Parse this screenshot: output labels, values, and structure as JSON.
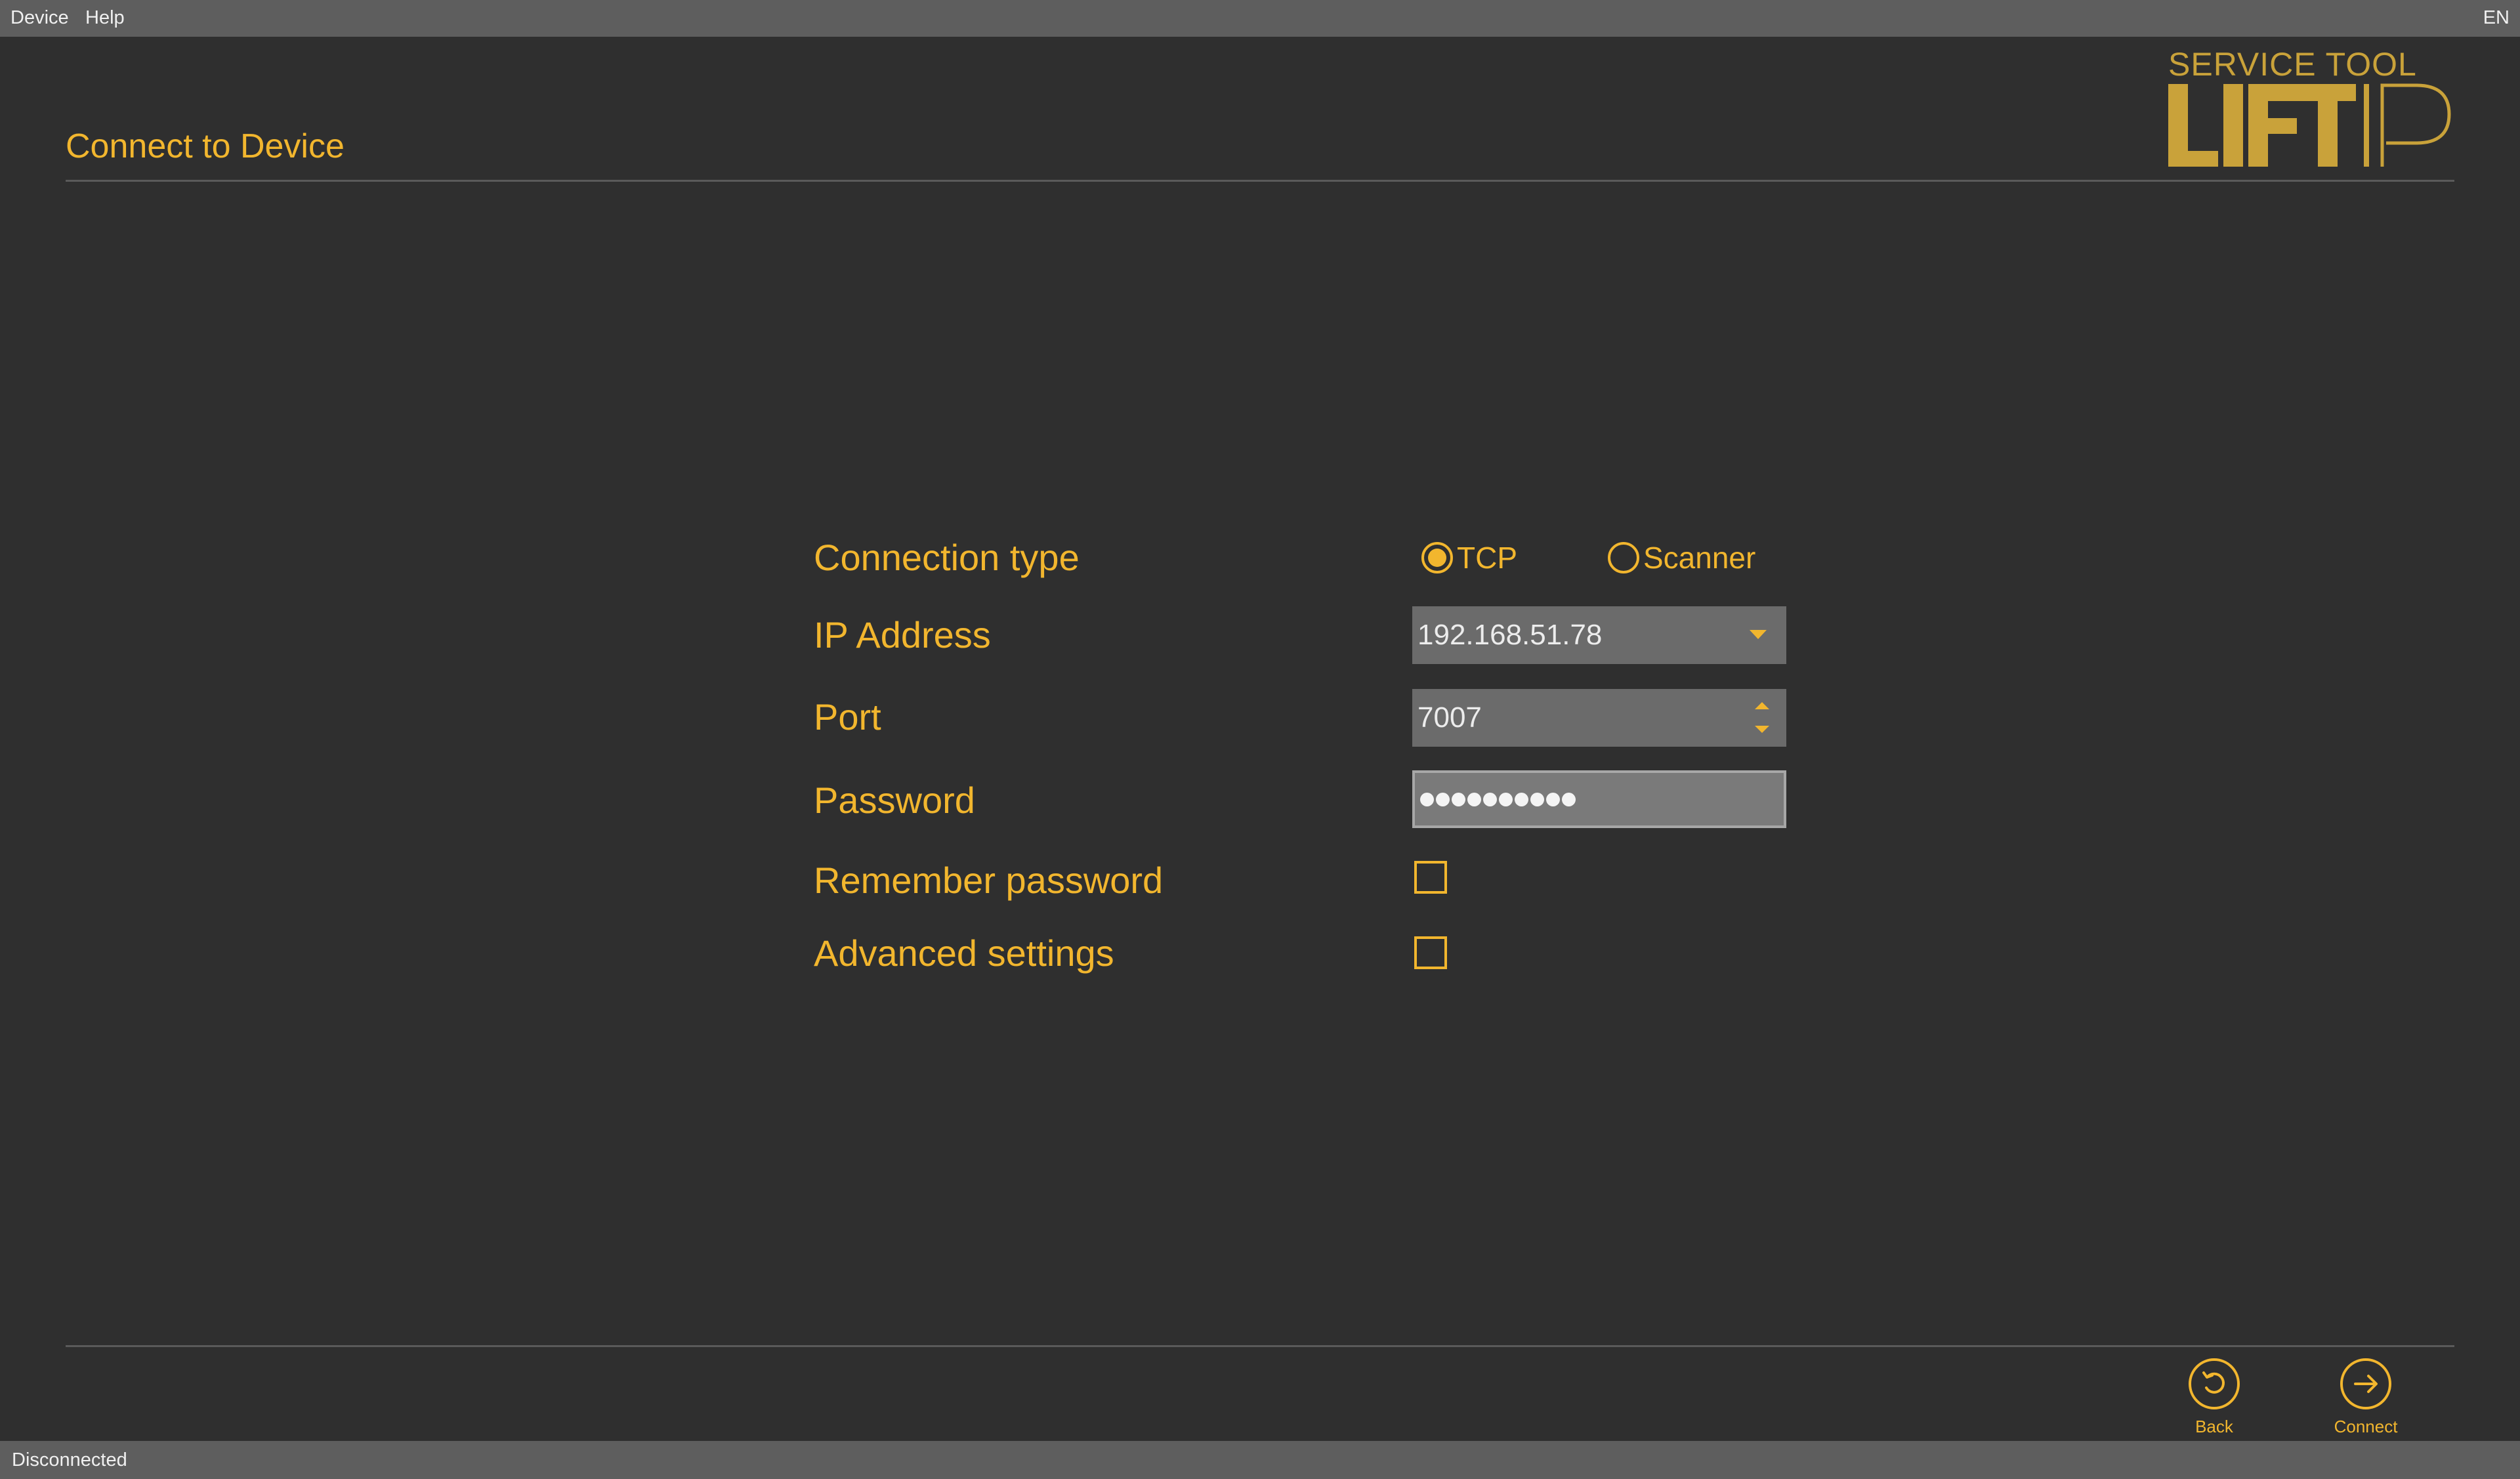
{
  "menubar": {
    "items": [
      {
        "label": "Device"
      },
      {
        "label": "Help"
      }
    ],
    "language": "EN"
  },
  "header": {
    "title": "Connect to Device"
  },
  "logo": {
    "subtitle": "SERVICE TOOL",
    "wordmark": "LIFT IP"
  },
  "form": {
    "connection_type": {
      "label": "Connection type",
      "options": [
        {
          "label": "TCP",
          "selected": true
        },
        {
          "label": "Scanner",
          "selected": false
        }
      ]
    },
    "ip_address": {
      "label": "IP Address",
      "value": "192.168.51.78"
    },
    "port": {
      "label": "Port",
      "value": "7007"
    },
    "password": {
      "label": "Password",
      "masked_length": 10
    },
    "remember_password": {
      "label": "Remember password",
      "checked": false
    },
    "advanced_settings": {
      "label": "Advanced settings",
      "checked": false
    }
  },
  "actions": {
    "back": {
      "label": "Back",
      "icon": "undo-icon"
    },
    "connect": {
      "label": "Connect",
      "icon": "arrow-right-icon"
    }
  },
  "status": {
    "text": "Disconnected"
  },
  "colors": {
    "accent": "#f2b62e",
    "background": "#2f2f2f",
    "bar": "#5e5e5e",
    "field": "#6b6b6b"
  }
}
